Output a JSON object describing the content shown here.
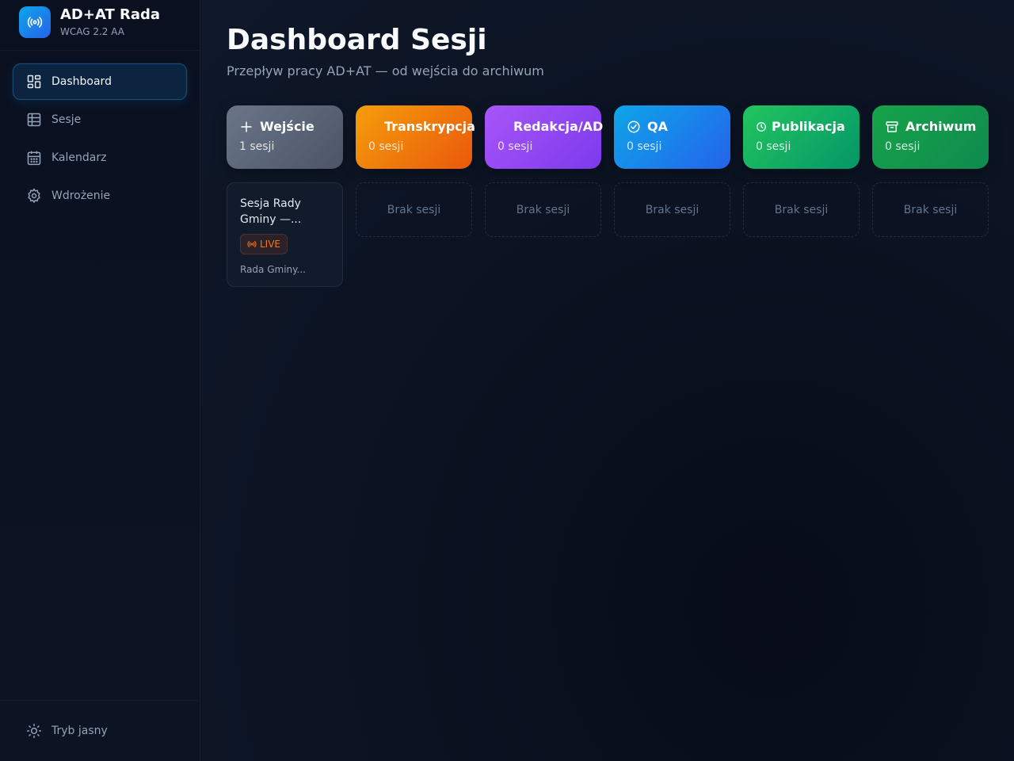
{
  "brand": {
    "title": "AD+AT Rada",
    "subtitle": "WCAG 2.2 AA",
    "icon": "broadcast-icon"
  },
  "nav": {
    "items": [
      {
        "label": "Dashboard",
        "icon": "dashboard-icon",
        "active": true
      },
      {
        "label": "Sesje",
        "icon": "table-icon"
      },
      {
        "label": "Kalendarz",
        "icon": "calendar-icon"
      },
      {
        "label": "Wdrożenie",
        "icon": "gear-icon"
      }
    ],
    "footer": {
      "label": "Tryb jasny",
      "icon": "sun-icon"
    }
  },
  "header": {
    "title": "Dashboard Sesji",
    "subtitle": "Przepływ pracy AD+AT — od wejścia do archiwum"
  },
  "stages": [
    {
      "label": "Wejście",
      "count": "1 sesji",
      "icon": "plus-icon",
      "color": "#5f697b"
    },
    {
      "label": "Transkrypcja",
      "count": "0 sesji",
      "icon": "",
      "color": "#f2790d"
    },
    {
      "label": "Redakcja/AD",
      "count": "0 sesji",
      "icon": "",
      "color": "#9147f5"
    },
    {
      "label": "QA",
      "count": "0 sesji",
      "icon": "check-circle-icon",
      "color": "#1382eb"
    },
    {
      "label": "Publikacja",
      "count": "0 sesji",
      "icon": "clock-icon",
      "color": "#16b167"
    },
    {
      "label": "Archiwum",
      "count": "0 sesji",
      "icon": "archive-icon",
      "color": "#12964f"
    }
  ],
  "session_card": {
    "title": "Sesja Rady Gminy —...",
    "badge": "LIVE",
    "meta": "Rada Gminy..."
  },
  "empty_label": "Brak sesji"
}
